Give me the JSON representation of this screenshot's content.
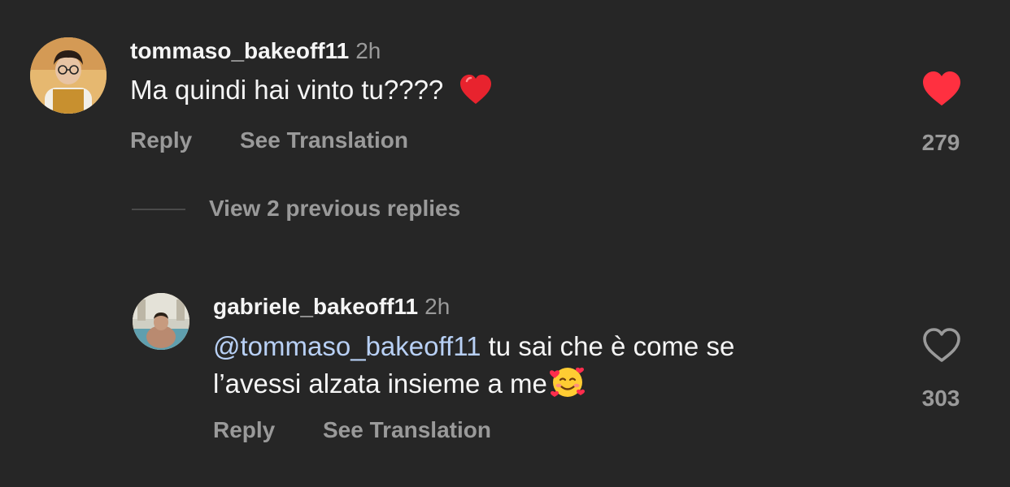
{
  "comment": {
    "username": "tommaso_bakeoff11",
    "time": "2h",
    "text": "Ma quindi hai vinto tu????",
    "liked": true,
    "like_count": "279",
    "reply_label": "Reply",
    "translate_label": "See Translation"
  },
  "view_replies": {
    "label": "View 2 previous replies"
  },
  "reply": {
    "username": "gabriele_bakeoff11",
    "time": "2h",
    "mention": "@tommaso_bakeoff11",
    "text_line1": " tu sai che è come se",
    "text_line2": "l’avessi alzata insieme a me",
    "liked": false,
    "like_count": "303",
    "reply_label": "Reply",
    "translate_label": "See Translation"
  },
  "colors": {
    "background": "#262626",
    "heart_red": "#ff3040",
    "secondary_text": "#9a9a9a",
    "mention_blue": "#b8d0f5"
  },
  "icons": {
    "heart_filled": "heart-filled-icon",
    "heart_outline": "heart-outline-icon",
    "heart_emoji": "red-heart-emoji",
    "smiling_hearts_emoji": "smiling-face-with-hearts-emoji"
  }
}
